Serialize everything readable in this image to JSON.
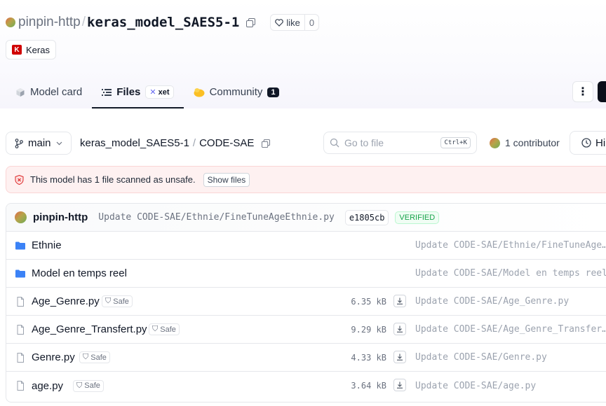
{
  "repo": {
    "owner": "pinpin-http",
    "separator": "/",
    "name": "keras_model_SAES5-1",
    "like_label": "like",
    "like_count": "0",
    "tag": "Keras"
  },
  "tabs": [
    {
      "label": "Model card",
      "icon": "cube-icon"
    },
    {
      "label": "Files",
      "badge": "xet",
      "icon": "files-icon"
    },
    {
      "label": "Community",
      "count": "1",
      "icon": "community-icon"
    }
  ],
  "toolbar": {
    "branch": "main",
    "breadcrumb": [
      "keras_model_SAES5-1",
      "CODE-SAE"
    ],
    "goto_placeholder": "Go to file",
    "goto_shortcut": "Ctrl+K",
    "contributors": "1 contributor",
    "history_label": "Hi"
  },
  "alert": {
    "text": "This model has 1 file scanned as unsafe.",
    "button": "Show files"
  },
  "last_commit": {
    "author": "pinpin-http",
    "message": "Update CODE-SAE/Ethnie/FineTuneAgeEthnie.py",
    "hash": "e1805cb",
    "status": "VERIFIED"
  },
  "files": [
    {
      "type": "folder",
      "name": "Ethnie",
      "commit": "Update CODE-SAE/Ethnie/FineTuneAgeEthnie.py"
    },
    {
      "type": "folder",
      "name": "Model en temps reel",
      "commit": "Update CODE-SAE/Model en temps reel"
    },
    {
      "type": "file",
      "name": "Age_Genre.py",
      "safe": "Safe",
      "size": "6.35 kB",
      "commit": "Update CODE-SAE/Age_Genre.py"
    },
    {
      "type": "file",
      "name": "Age_Genre_Transfert.py",
      "safe": "Safe",
      "size": "9.29 kB",
      "commit": "Update CODE-SAE/Age_Genre_Transfert.py"
    },
    {
      "type": "file",
      "name": "Genre.py",
      "safe": "Safe",
      "size": "4.33 kB",
      "commit": "Update CODE-SAE/Genre.py"
    },
    {
      "type": "file",
      "name": "age.py",
      "safe": "Safe",
      "size": "3.64 kB",
      "commit": "Update CODE-SAE/age.py"
    }
  ],
  "colors": {
    "folder": "#3b82f6",
    "alert_bg": "#fef1f1",
    "verified": "#16a34a",
    "keras": "#d00000"
  }
}
